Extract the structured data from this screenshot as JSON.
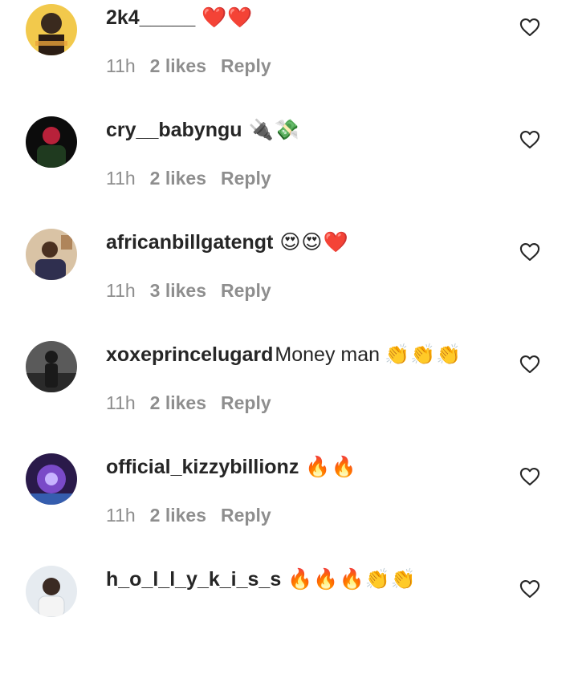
{
  "comments": [
    {
      "username": "2k4_____",
      "text": "",
      "emoji": "❤️❤️",
      "time": "11h",
      "likes": "2 likes",
      "reply": "Reply"
    },
    {
      "username": "cry__babyngu",
      "text": "",
      "emoji": "🔌💸",
      "time": "11h",
      "likes": "2 likes",
      "reply": "Reply"
    },
    {
      "username": "africanbillgatengt",
      "text": "",
      "emoji": "😍😍❤️",
      "time": "11h",
      "likes": "3 likes",
      "reply": "Reply"
    },
    {
      "username": "xoxeprincelugard",
      "text": "Money man",
      "emoji": "👏👏👏",
      "time": "11h",
      "likes": "2 likes",
      "reply": "Reply"
    },
    {
      "username": "official_kizzybillionz",
      "text": "",
      "emoji": "🔥🔥",
      "time": "11h",
      "likes": "2 likes",
      "reply": "Reply"
    },
    {
      "username": "h_o_l_l_y_k_i_s_s",
      "text": "",
      "emoji": "🔥🔥🔥👏👏",
      "time": "11h",
      "likes": "",
      "reply": ""
    }
  ],
  "icons": {
    "like": "heart-outline-icon"
  }
}
